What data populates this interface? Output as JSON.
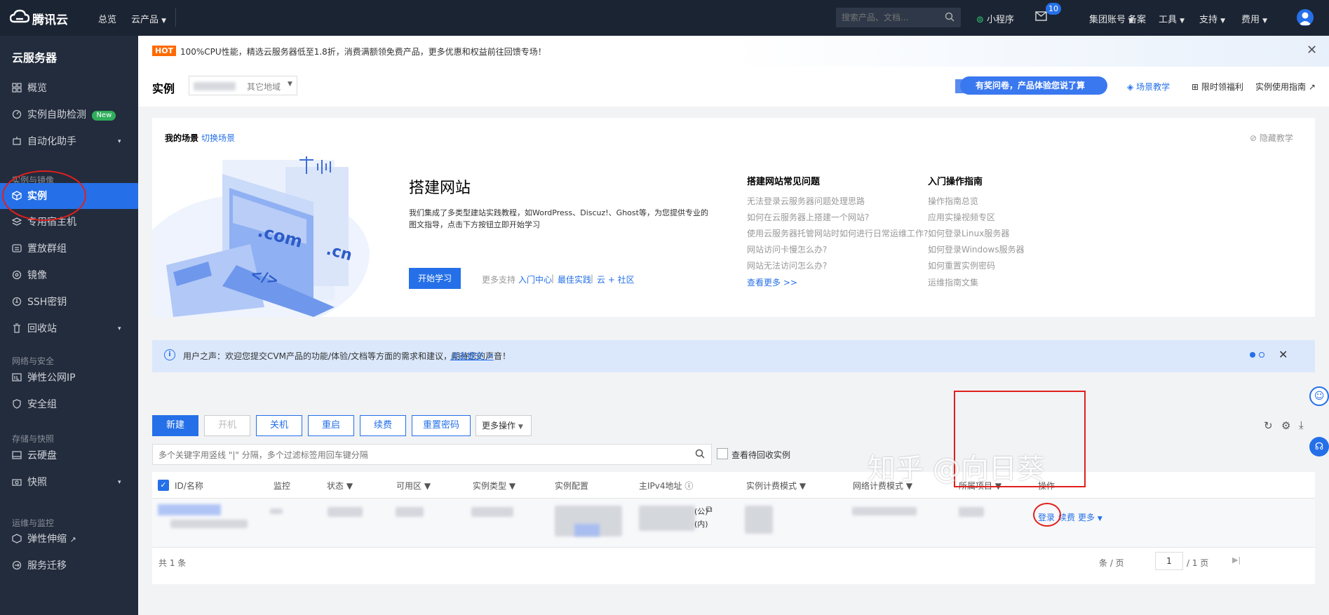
{
  "topbar": {
    "logo_text": "腾讯云",
    "nav_overview": "总览",
    "nav_products": "云产品",
    "search_placeholder": "搜索产品、文档...",
    "miniprogram": "小程序",
    "mail_badge": "10",
    "group_account": "集团账号",
    "beian": "备案",
    "tools": "工具",
    "support": "支持",
    "fees": "费用"
  },
  "sidebar": {
    "title": "云服务器",
    "items": [
      {
        "label": "概览",
        "icon": "grid-icon"
      },
      {
        "label": "实例自助检测",
        "icon": "dashboard-icon",
        "badge": "New"
      },
      {
        "label": "自动化助手",
        "icon": "robot-icon"
      }
    ],
    "group1": "实例与镜像",
    "group1_items": [
      {
        "label": "实例",
        "icon": "cube-icon"
      },
      {
        "label": "专用宿主机",
        "icon": "stack-icon"
      },
      {
        "label": "置放群组",
        "icon": "group-icon"
      },
      {
        "label": "镜像",
        "icon": "disc-icon"
      },
      {
        "label": "SSH密钥",
        "icon": "key-icon"
      },
      {
        "label": "回收站",
        "icon": "trash-icon"
      }
    ],
    "group2": "网络与安全",
    "group2_items": [
      {
        "label": "弹性公网IP",
        "icon": "ip-icon"
      },
      {
        "label": "安全组",
        "icon": "shield-icon"
      }
    ],
    "group3": "存储与快照",
    "group3_items": [
      {
        "label": "云硬盘",
        "icon": "disk-icon"
      },
      {
        "label": "快照",
        "icon": "camera-icon"
      }
    ],
    "group4": "运维与监控",
    "group4_items": [
      {
        "label": "弹性伸缩",
        "icon": "scale-icon"
      },
      {
        "label": "服务迁移",
        "icon": "migrate-icon"
      }
    ]
  },
  "promo": {
    "badge": "HOT",
    "text": "100%CPU性能，精选云服务器低至1.8折，消费满额领免费产品，更多优惠和权益前往回馈专场！"
  },
  "header": {
    "title": "实例",
    "region_other": "其它地域",
    "survey": "有奖问卷，产品体验您说了算",
    "scene_tutorial": "场景教学",
    "limited_benefit": "限时领福利",
    "guide": "实例使用指南"
  },
  "scene": {
    "my_scene": "我的场景",
    "switch": "切换场景",
    "hide": "隐藏教学",
    "heading": "搭建网站",
    "desc": "我们集成了多类型建站实践教程，如WordPress、Discuz!、Ghost等，为您提供专业的图文指导，点击下方按钮立即开始学习",
    "start_btn": "开始学习",
    "more_support": "更多支持",
    "link_entry": "入门中心",
    "link_best": "最佳实践",
    "link_community": "云 + 社区",
    "illus_com": ".com",
    "illus_cn": ".cn",
    "illus_code": "</>",
    "faq_title": "搭建网站常见问题",
    "faq": [
      "无法登录云服务器问题处理思路",
      "如何在云服务器上搭建一个网站?",
      "使用云服务器托管网站时如何进行日常运维工作?",
      "网站访问卡慢怎么办?",
      "网站无法访问怎么办?"
    ],
    "faq_more": "查看更多 >>",
    "guide_title": "入门操作指南",
    "guides": [
      "操作指南总览",
      "应用实操视频专区",
      "如何登录Linux服务器",
      "如何登录Windows服务器",
      "如何重置实例密码",
      "运维指南文集"
    ]
  },
  "notice": {
    "text": "用户之声：欢迎您提交CVM产品的功能/体验/文档等方面的需求和建议，期待您的声音！",
    "link": "点击提交"
  },
  "toolbar": {
    "new": "新建",
    "start": "开机",
    "stop": "关机",
    "restart": "重启",
    "renew": "续费",
    "reset_pwd": "重置密码",
    "more": "更多操作"
  },
  "filter": {
    "placeholder": "多个关键字用竖线 \"|\" 分隔，多个过滤标签用回车键分隔",
    "recycle": "查看待回收实例"
  },
  "table": {
    "headers": [
      "ID/名称",
      "监控",
      "状态",
      "可用区",
      "实例类型",
      "实例配置",
      "主IPv4地址",
      "实例计费模式",
      "网络计费模式",
      "所属项目",
      "操作"
    ],
    "row_actions": {
      "login": "登录",
      "renew": "续费",
      "more": "更多"
    },
    "row_ip_pub": "(公)",
    "row_ip_priv": "(内)"
  },
  "footer": {
    "total": "共 1 条",
    "per_page": "条 / 页",
    "page": "1",
    "pages": "/ 1 页"
  },
  "watermark": "知乎 @向日葵",
  "colors": {
    "accent": "#2570e8",
    "sidebar": "#232c3d",
    "topbar": "#1b2433",
    "annotation": "#e0201c"
  }
}
